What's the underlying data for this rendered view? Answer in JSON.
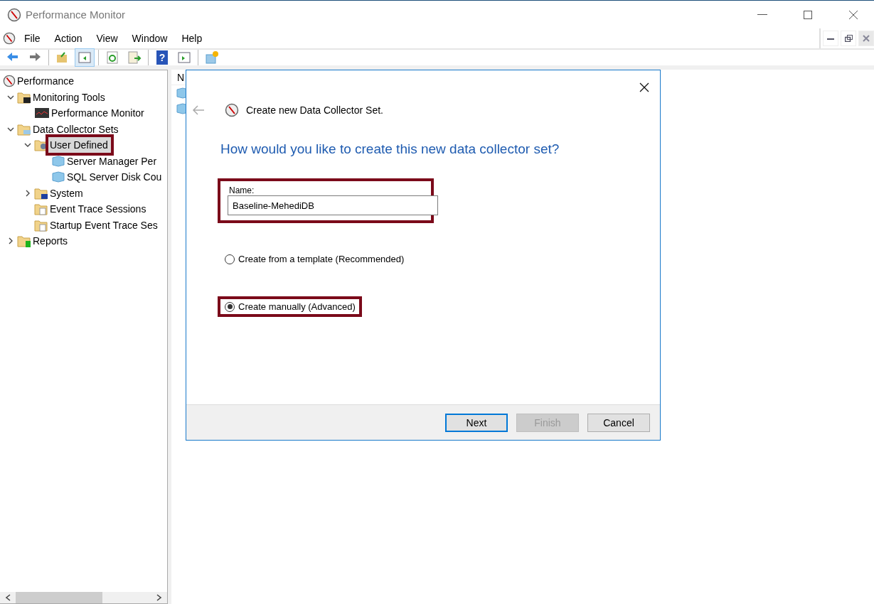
{
  "window": {
    "title": "Performance Monitor"
  },
  "menu": [
    {
      "label": "File"
    },
    {
      "label": "Action"
    },
    {
      "label": "View"
    },
    {
      "label": "Window"
    },
    {
      "label": "Help"
    }
  ],
  "toolbar": [
    {
      "kind": "back",
      "selected": false
    },
    {
      "kind": "forward",
      "selected": false
    },
    {
      "kind": "sep"
    },
    {
      "kind": "up",
      "selected": false
    },
    {
      "kind": "tree",
      "selected": true
    },
    {
      "kind": "sep"
    },
    {
      "kind": "refresh",
      "selected": false
    },
    {
      "kind": "export",
      "selected": false
    },
    {
      "kind": "sep"
    },
    {
      "kind": "help",
      "selected": false,
      "label": "?"
    },
    {
      "kind": "pane",
      "selected": false
    },
    {
      "kind": "sep"
    },
    {
      "kind": "newwin",
      "selected": false
    }
  ],
  "tree": [
    {
      "label": "Performance",
      "kind": "perf",
      "children": [
        {
          "label": "Monitoring Tools",
          "kind": "foldermon",
          "expanded": true,
          "children": [
            {
              "label": "Performance Monitor",
              "kind": "monitor"
            }
          ]
        },
        {
          "label": "Data Collector Sets",
          "kind": "folderdcs",
          "expanded": true,
          "children": [
            {
              "label": "User Defined",
              "kind": "folderuser",
              "expanded": true,
              "selected": true,
              "highlighted": true,
              "children": [
                {
                  "label": "Server Manager Per",
                  "kind": "cube"
                },
                {
                  "label": "SQL Server Disk Cou",
                  "kind": "cube"
                }
              ]
            },
            {
              "label": "System",
              "kind": "foldersys",
              "expanded": false
            },
            {
              "label": "Event Trace Sessions",
              "kind": "foldertrace"
            },
            {
              "label": "Startup Event Trace Ses",
              "kind": "foldertrace"
            }
          ]
        },
        {
          "label": "Reports",
          "kind": "folderrep",
          "expanded": false
        }
      ]
    }
  ],
  "list": {
    "column_1": "N"
  },
  "dialog": {
    "title": "Create new Data Collector Set.",
    "question": "How would you like to create this new data collector set?",
    "name_field": {
      "label": "Name:",
      "value": "Baseline-MehediDB",
      "highlighted": true
    },
    "options": [
      {
        "label": "Create from a template (Recommended)",
        "selected": false,
        "highlighted": false
      },
      {
        "label": "Create manually (Advanced)",
        "selected": true,
        "highlighted": true
      }
    ],
    "buttons": [
      {
        "label": "Next",
        "disabled": false,
        "default": true
      },
      {
        "label": "Finish",
        "disabled": true,
        "default": false
      },
      {
        "label": "Cancel",
        "disabled": false,
        "default": false
      }
    ]
  }
}
